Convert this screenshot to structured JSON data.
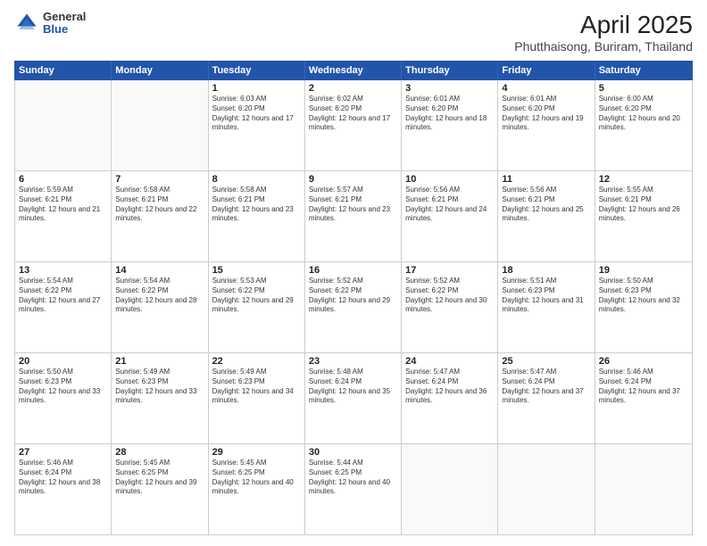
{
  "logo": {
    "general": "General",
    "blue": "Blue"
  },
  "title": "April 2025",
  "subtitle": "Phutthaisong, Buriram, Thailand",
  "days": [
    "Sunday",
    "Monday",
    "Tuesday",
    "Wednesday",
    "Thursday",
    "Friday",
    "Saturday"
  ],
  "weeks": [
    [
      {
        "day": "",
        "info": ""
      },
      {
        "day": "",
        "info": ""
      },
      {
        "day": "1",
        "info": "Sunrise: 6:03 AM\nSunset: 6:20 PM\nDaylight: 12 hours and 17 minutes."
      },
      {
        "day": "2",
        "info": "Sunrise: 6:02 AM\nSunset: 6:20 PM\nDaylight: 12 hours and 17 minutes."
      },
      {
        "day": "3",
        "info": "Sunrise: 6:01 AM\nSunset: 6:20 PM\nDaylight: 12 hours and 18 minutes."
      },
      {
        "day": "4",
        "info": "Sunrise: 6:01 AM\nSunset: 6:20 PM\nDaylight: 12 hours and 19 minutes."
      },
      {
        "day": "5",
        "info": "Sunrise: 6:00 AM\nSunset: 6:20 PM\nDaylight: 12 hours and 20 minutes."
      }
    ],
    [
      {
        "day": "6",
        "info": "Sunrise: 5:59 AM\nSunset: 6:21 PM\nDaylight: 12 hours and 21 minutes."
      },
      {
        "day": "7",
        "info": "Sunrise: 5:58 AM\nSunset: 6:21 PM\nDaylight: 12 hours and 22 minutes."
      },
      {
        "day": "8",
        "info": "Sunrise: 5:58 AM\nSunset: 6:21 PM\nDaylight: 12 hours and 23 minutes."
      },
      {
        "day": "9",
        "info": "Sunrise: 5:57 AM\nSunset: 6:21 PM\nDaylight: 12 hours and 23 minutes."
      },
      {
        "day": "10",
        "info": "Sunrise: 5:56 AM\nSunset: 6:21 PM\nDaylight: 12 hours and 24 minutes."
      },
      {
        "day": "11",
        "info": "Sunrise: 5:56 AM\nSunset: 6:21 PM\nDaylight: 12 hours and 25 minutes."
      },
      {
        "day": "12",
        "info": "Sunrise: 5:55 AM\nSunset: 6:21 PM\nDaylight: 12 hours and 26 minutes."
      }
    ],
    [
      {
        "day": "13",
        "info": "Sunrise: 5:54 AM\nSunset: 6:22 PM\nDaylight: 12 hours and 27 minutes."
      },
      {
        "day": "14",
        "info": "Sunrise: 5:54 AM\nSunset: 6:22 PM\nDaylight: 12 hours and 28 minutes."
      },
      {
        "day": "15",
        "info": "Sunrise: 5:53 AM\nSunset: 6:22 PM\nDaylight: 12 hours and 29 minutes."
      },
      {
        "day": "16",
        "info": "Sunrise: 5:52 AM\nSunset: 6:22 PM\nDaylight: 12 hours and 29 minutes."
      },
      {
        "day": "17",
        "info": "Sunrise: 5:52 AM\nSunset: 6:22 PM\nDaylight: 12 hours and 30 minutes."
      },
      {
        "day": "18",
        "info": "Sunrise: 5:51 AM\nSunset: 6:23 PM\nDaylight: 12 hours and 31 minutes."
      },
      {
        "day": "19",
        "info": "Sunrise: 5:50 AM\nSunset: 6:23 PM\nDaylight: 12 hours and 32 minutes."
      }
    ],
    [
      {
        "day": "20",
        "info": "Sunrise: 5:50 AM\nSunset: 6:23 PM\nDaylight: 12 hours and 33 minutes."
      },
      {
        "day": "21",
        "info": "Sunrise: 5:49 AM\nSunset: 6:23 PM\nDaylight: 12 hours and 33 minutes."
      },
      {
        "day": "22",
        "info": "Sunrise: 5:49 AM\nSunset: 6:23 PM\nDaylight: 12 hours and 34 minutes."
      },
      {
        "day": "23",
        "info": "Sunrise: 5:48 AM\nSunset: 6:24 PM\nDaylight: 12 hours and 35 minutes."
      },
      {
        "day": "24",
        "info": "Sunrise: 5:47 AM\nSunset: 6:24 PM\nDaylight: 12 hours and 36 minutes."
      },
      {
        "day": "25",
        "info": "Sunrise: 5:47 AM\nSunset: 6:24 PM\nDaylight: 12 hours and 37 minutes."
      },
      {
        "day": "26",
        "info": "Sunrise: 5:46 AM\nSunset: 6:24 PM\nDaylight: 12 hours and 37 minutes."
      }
    ],
    [
      {
        "day": "27",
        "info": "Sunrise: 5:46 AM\nSunset: 6:24 PM\nDaylight: 12 hours and 38 minutes."
      },
      {
        "day": "28",
        "info": "Sunrise: 5:45 AM\nSunset: 6:25 PM\nDaylight: 12 hours and 39 minutes."
      },
      {
        "day": "29",
        "info": "Sunrise: 5:45 AM\nSunset: 6:25 PM\nDaylight: 12 hours and 40 minutes."
      },
      {
        "day": "30",
        "info": "Sunrise: 5:44 AM\nSunset: 6:25 PM\nDaylight: 12 hours and 40 minutes."
      },
      {
        "day": "",
        "info": ""
      },
      {
        "day": "",
        "info": ""
      },
      {
        "day": "",
        "info": ""
      }
    ]
  ]
}
